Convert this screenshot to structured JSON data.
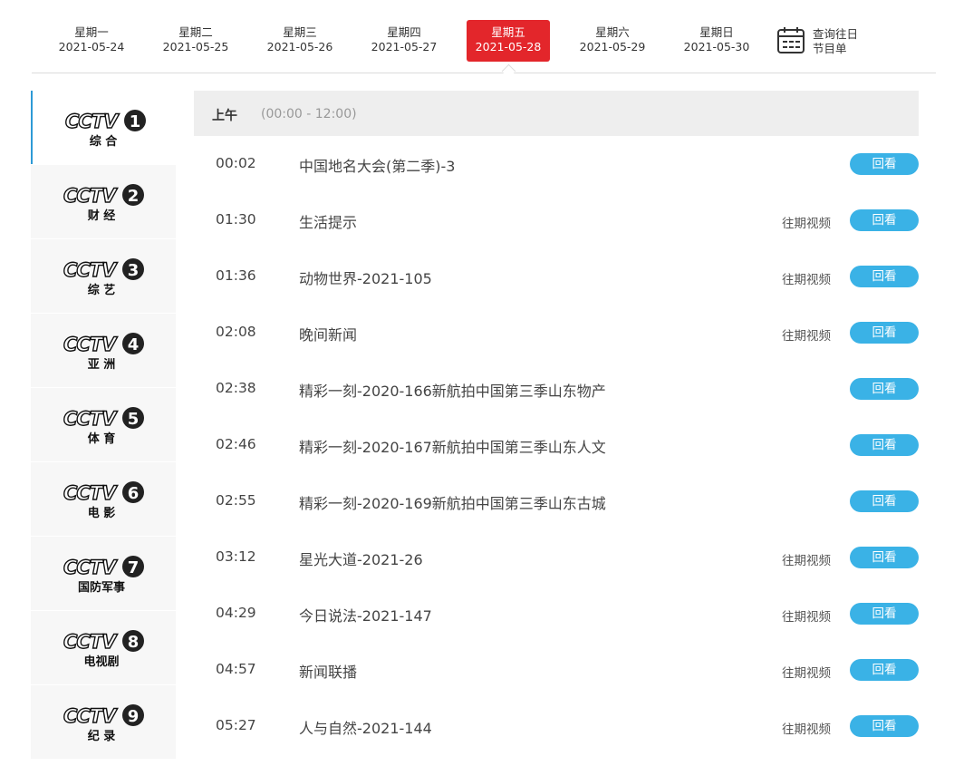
{
  "dates": [
    {
      "weekday": "星期一",
      "date": "2021-05-24",
      "active": false
    },
    {
      "weekday": "星期二",
      "date": "2021-05-25",
      "active": false
    },
    {
      "weekday": "星期三",
      "date": "2021-05-26",
      "active": false
    },
    {
      "weekday": "星期四",
      "date": "2021-05-27",
      "active": false
    },
    {
      "weekday": "星期五",
      "date": "2021-05-28",
      "active": true
    },
    {
      "weekday": "星期六",
      "date": "2021-05-29",
      "active": false
    },
    {
      "weekday": "星期日",
      "date": "2021-05-30",
      "active": false
    }
  ],
  "history": {
    "line1": "查询往日",
    "line2": "节目单",
    "icon": "calendar-icon"
  },
  "channels": [
    {
      "num": "1",
      "name": "综 合",
      "active": true
    },
    {
      "num": "2",
      "name": "财 经",
      "active": false
    },
    {
      "num": "3",
      "name": "综 艺",
      "active": false
    },
    {
      "num": "4",
      "name": "亚 洲",
      "active": false
    },
    {
      "num": "5",
      "name": "体 育",
      "active": false
    },
    {
      "num": "6",
      "name": "电 影",
      "active": false
    },
    {
      "num": "7",
      "name": "国防军事",
      "active": false
    },
    {
      "num": "8",
      "name": "电视剧",
      "active": false
    },
    {
      "num": "9",
      "name": "纪 录",
      "active": false
    }
  ],
  "logo_text": "CCTV",
  "section": {
    "label": "上午",
    "range": "(00:00 - 12:00)"
  },
  "labels": {
    "replay": "回看",
    "past": "往期视频"
  },
  "programs": [
    {
      "time": "00:02",
      "title": "中国地名大会(第二季)-3",
      "past": false
    },
    {
      "time": "01:30",
      "title": "生活提示",
      "past": true
    },
    {
      "time": "01:36",
      "title": "动物世界-2021-105",
      "past": true
    },
    {
      "time": "02:08",
      "title": "晚间新闻",
      "past": true
    },
    {
      "time": "02:38",
      "title": "精彩一刻-2020-166新航拍中国第三季山东物产",
      "past": false
    },
    {
      "time": "02:46",
      "title": "精彩一刻-2020-167新航拍中国第三季山东人文",
      "past": false
    },
    {
      "time": "02:55",
      "title": "精彩一刻-2020-169新航拍中国第三季山东古城",
      "past": false
    },
    {
      "time": "03:12",
      "title": "星光大道-2021-26",
      "past": true
    },
    {
      "time": "04:29",
      "title": "今日说法-2021-147",
      "past": true
    },
    {
      "time": "04:57",
      "title": "新闻联播",
      "past": true
    },
    {
      "time": "05:27",
      "title": "人与自然-2021-144",
      "past": true
    }
  ],
  "colors": {
    "active_day": "#e3262b",
    "replay_button": "#3ab2e6",
    "active_channel_border": "#2e9ad6"
  }
}
